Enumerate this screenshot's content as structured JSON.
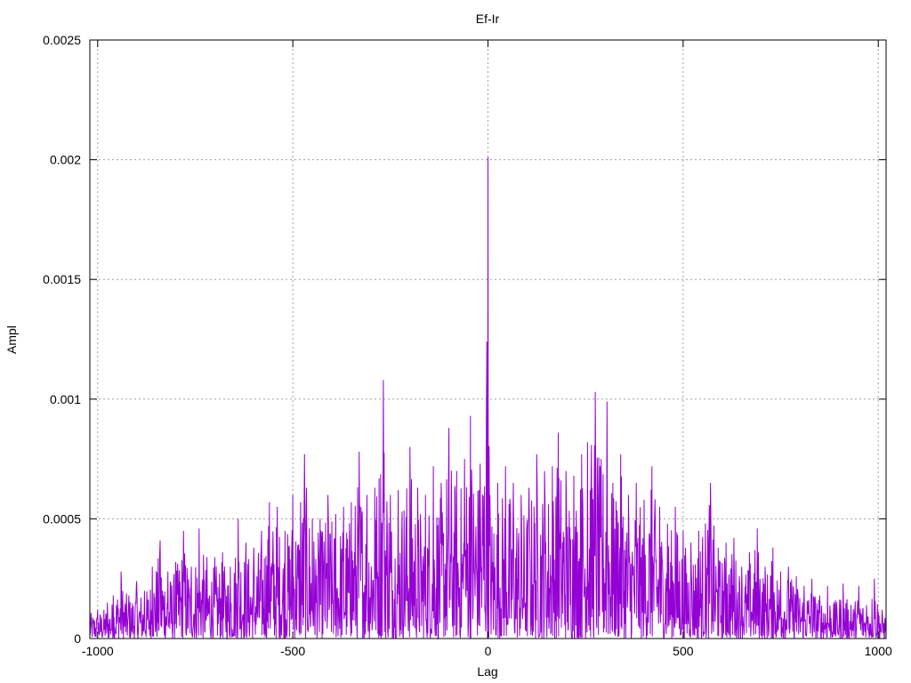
{
  "chart_data": {
    "type": "line",
    "title": "Ef-Ir",
    "xlabel": "Lag",
    "ylabel": "Ampl",
    "xlim": [
      -1020,
      1020
    ],
    "ylim": [
      0,
      0.0025
    ],
    "xticks": [
      -1000,
      -500,
      0,
      500,
      1000
    ],
    "xtick_labels": [
      "-1000",
      "-500",
      "0",
      "500",
      "1000"
    ],
    "yticks": [
      0,
      0.0005,
      0.001,
      0.0015,
      0.002,
      0.0025
    ],
    "ytick_labels": [
      "0",
      "0.0005",
      "0.001",
      "0.0015",
      "0.002",
      "0.0025"
    ],
    "grid": true,
    "series": [
      {
        "color": "#9400d3",
        "peaks": [
          {
            "x": -1000,
            "y": 0.00012
          },
          {
            "x": -975,
            "y": 0.00015
          },
          {
            "x": -960,
            "y": 0.00018
          },
          {
            "x": -940,
            "y": 0.00028
          },
          {
            "x": -920,
            "y": 0.00018
          },
          {
            "x": -900,
            "y": 0.00024
          },
          {
            "x": -880,
            "y": 0.0002
          },
          {
            "x": -860,
            "y": 0.0003
          },
          {
            "x": -840,
            "y": 0.00041
          },
          {
            "x": -820,
            "y": 0.00028
          },
          {
            "x": -800,
            "y": 0.00032
          },
          {
            "x": -780,
            "y": 0.00045
          },
          {
            "x": -760,
            "y": 0.0003
          },
          {
            "x": -740,
            "y": 0.00046
          },
          {
            "x": -720,
            "y": 0.00034
          },
          {
            "x": -700,
            "y": 0.00034
          },
          {
            "x": -680,
            "y": 0.00036
          },
          {
            "x": -660,
            "y": 0.0003
          },
          {
            "x": -640,
            "y": 0.0005
          },
          {
            "x": -620,
            "y": 0.0004
          },
          {
            "x": -600,
            "y": 0.00038
          },
          {
            "x": -580,
            "y": 0.00045
          },
          {
            "x": -560,
            "y": 0.00057
          },
          {
            "x": -540,
            "y": 0.00055
          },
          {
            "x": -520,
            "y": 0.00045
          },
          {
            "x": -500,
            "y": 0.0006
          },
          {
            "x": -480,
            "y": 0.00057
          },
          {
            "x": -470,
            "y": 0.00077
          },
          {
            "x": -450,
            "y": 0.0005
          },
          {
            "x": -430,
            "y": 0.0005
          },
          {
            "x": -410,
            "y": 0.0006
          },
          {
            "x": -390,
            "y": 0.00052
          },
          {
            "x": -370,
            "y": 0.00055
          },
          {
            "x": -350,
            "y": 0.00057
          },
          {
            "x": -330,
            "y": 0.00078
          },
          {
            "x": -310,
            "y": 0.0006
          },
          {
            "x": -290,
            "y": 0.00063
          },
          {
            "x": -268,
            "y": 0.00108
          },
          {
            "x": -250,
            "y": 0.0006
          },
          {
            "x": -230,
            "y": 0.00062
          },
          {
            "x": -200,
            "y": 0.0008
          },
          {
            "x": -180,
            "y": 0.00063
          },
          {
            "x": -160,
            "y": 0.0006
          },
          {
            "x": -140,
            "y": 0.00072
          },
          {
            "x": -120,
            "y": 0.00065
          },
          {
            "x": -100,
            "y": 0.00088
          },
          {
            "x": -80,
            "y": 0.0007
          },
          {
            "x": -60,
            "y": 0.00075
          },
          {
            "x": -45,
            "y": 0.00093
          },
          {
            "x": -20,
            "y": 0.00073
          },
          {
            "x": -3,
            "y": 0.00124
          },
          {
            "x": 0,
            "y": 0.00201
          },
          {
            "x": 5,
            "y": 0.0006
          },
          {
            "x": 25,
            "y": 0.00065
          },
          {
            "x": 45,
            "y": 0.00072
          },
          {
            "x": 65,
            "y": 0.00065
          },
          {
            "x": 85,
            "y": 0.0006
          },
          {
            "x": 105,
            "y": 0.00063
          },
          {
            "x": 125,
            "y": 0.00077
          },
          {
            "x": 145,
            "y": 0.0007
          },
          {
            "x": 165,
            "y": 0.00072
          },
          {
            "x": 180,
            "y": 0.00086
          },
          {
            "x": 200,
            "y": 0.0007
          },
          {
            "x": 220,
            "y": 0.00068
          },
          {
            "x": 240,
            "y": 0.00077
          },
          {
            "x": 255,
            "y": 0.00082
          },
          {
            "x": 275,
            "y": 0.00103
          },
          {
            "x": 290,
            "y": 0.00075
          },
          {
            "x": 305,
            "y": 0.00099
          },
          {
            "x": 320,
            "y": 0.00065
          },
          {
            "x": 340,
            "y": 0.00077
          },
          {
            "x": 360,
            "y": 0.0006
          },
          {
            "x": 380,
            "y": 0.00065
          },
          {
            "x": 400,
            "y": 0.00058
          },
          {
            "x": 420,
            "y": 0.00072
          },
          {
            "x": 440,
            "y": 0.00055
          },
          {
            "x": 460,
            "y": 0.00048
          },
          {
            "x": 480,
            "y": 0.00055
          },
          {
            "x": 500,
            "y": 0.00045
          },
          {
            "x": 520,
            "y": 0.0004
          },
          {
            "x": 540,
            "y": 0.00045
          },
          {
            "x": 570,
            "y": 0.00065
          },
          {
            "x": 590,
            "y": 0.00038
          },
          {
            "x": 610,
            "y": 0.0004
          },
          {
            "x": 630,
            "y": 0.00042
          },
          {
            "x": 650,
            "y": 0.0003
          },
          {
            "x": 670,
            "y": 0.00036
          },
          {
            "x": 690,
            "y": 0.00046
          },
          {
            "x": 710,
            "y": 0.0003
          },
          {
            "x": 730,
            "y": 0.00038
          },
          {
            "x": 750,
            "y": 0.00028
          },
          {
            "x": 770,
            "y": 0.0003
          },
          {
            "x": 790,
            "y": 0.00026
          },
          {
            "x": 810,
            "y": 0.00022
          },
          {
            "x": 830,
            "y": 0.00025
          },
          {
            "x": 850,
            "y": 0.00018
          },
          {
            "x": 870,
            "y": 0.00022
          },
          {
            "x": 890,
            "y": 0.00016
          },
          {
            "x": 910,
            "y": 0.00023
          },
          {
            "x": 930,
            "y": 0.00014
          },
          {
            "x": 950,
            "y": 0.00022
          },
          {
            "x": 970,
            "y": 0.00014
          },
          {
            "x": 990,
            "y": 0.00025
          },
          {
            "x": 1010,
            "y": 0.00012
          }
        ]
      }
    ]
  }
}
